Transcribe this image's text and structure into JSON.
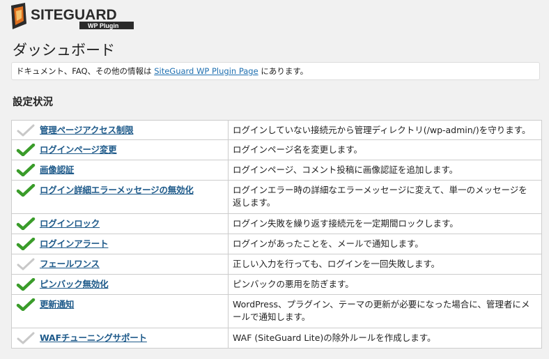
{
  "logo": {
    "brand": "SITEGUARD",
    "sub": "WP Plugin"
  },
  "page": {
    "title": "ダッシュボード"
  },
  "notice": {
    "prefix": "ドキュメント、FAQ、その他の情報は ",
    "link_text": "SiteGuard WP Plugin Page",
    "suffix": " にあります。"
  },
  "section": {
    "title": "設定状況"
  },
  "features": [
    {
      "name": "管理ページアクセス制限",
      "desc": "ログインしていない接続元から管理ディレクトリ(/wp-admin/)を守ります。",
      "enabled": false
    },
    {
      "name": "ログインページ変更",
      "desc": "ログインページ名を変更します。",
      "enabled": true
    },
    {
      "name": "画像認証",
      "desc": "ログインページ、コメント投稿に画像認証を追加します。",
      "enabled": true
    },
    {
      "name": "ログイン詳細エラーメッセージの無効化",
      "desc": "ログインエラー時の詳細なエラーメッセージに変えて、単一のメッセージを返します。",
      "enabled": true
    },
    {
      "name": "ログインロック",
      "desc": "ログイン失敗を繰り返す接続元を一定期間ロックします。",
      "enabled": true
    },
    {
      "name": "ログインアラート",
      "desc": "ログインがあったことを、メールで通知します。",
      "enabled": true
    },
    {
      "name": "フェールワンス",
      "desc": "正しい入力を行っても、ログインを一回失敗します。",
      "enabled": false
    },
    {
      "name": "ピンバック無効化",
      "desc": "ピンバックの悪用を防ぎます。",
      "enabled": true
    },
    {
      "name": "更新通知",
      "desc": "WordPress、プラグイン、テーマの更新が必要になった場合に、管理者にメールで通知します。",
      "enabled": true
    },
    {
      "name": "WAFチューニングサポート",
      "desc": "WAF (SiteGuard Lite)の除外ルールを作成します。",
      "enabled": false
    }
  ],
  "colors": {
    "check_on": "#3a9c2a",
    "check_off": "#c8c8c8",
    "link": "#1e5a8a"
  }
}
